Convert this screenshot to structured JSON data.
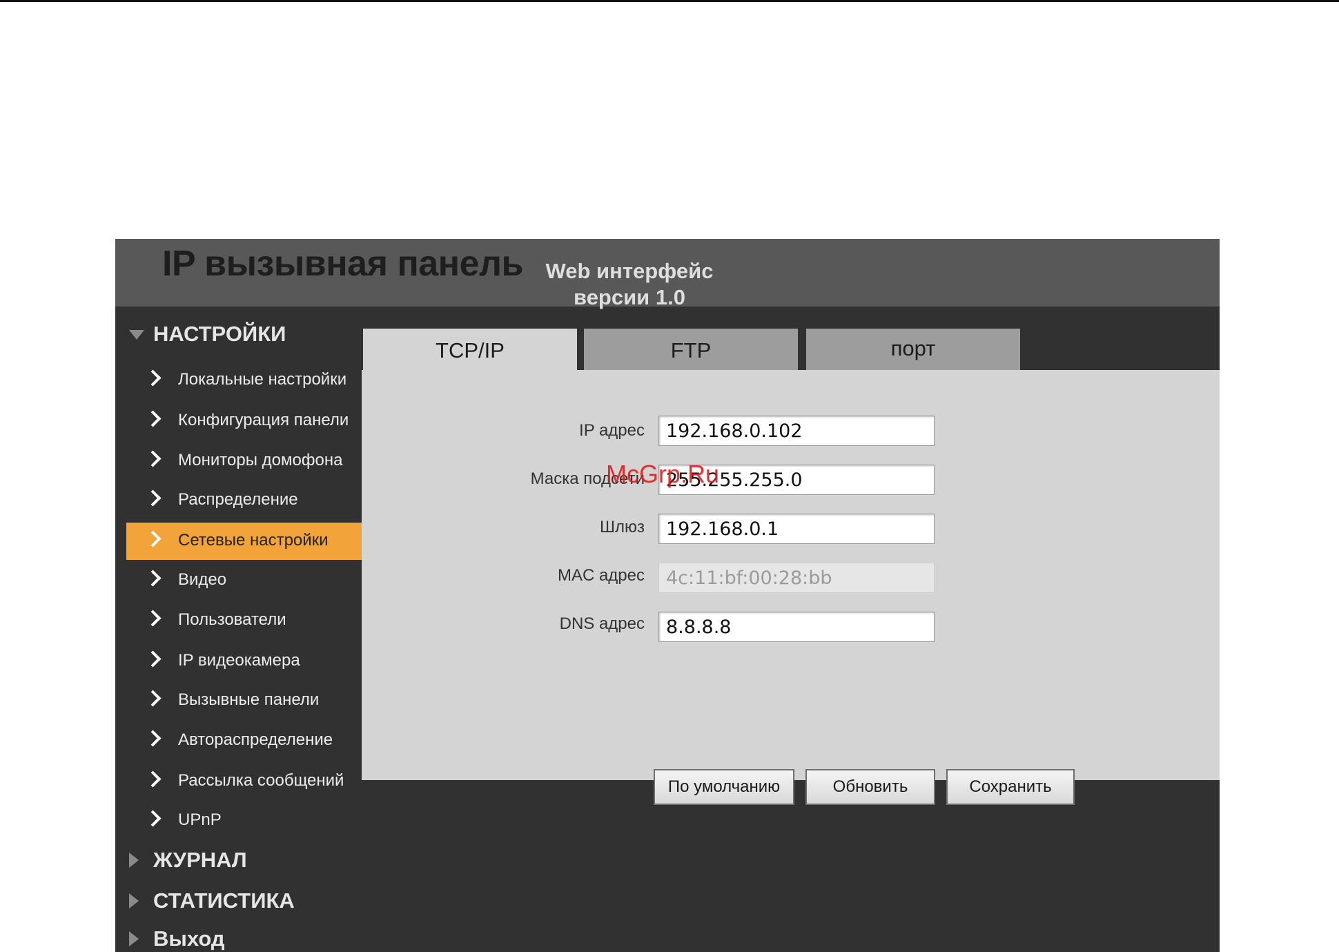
{
  "header": {
    "title": "IP вызывная панель",
    "subtitle_line1": "Web интерфейс",
    "subtitle_line2": "версии 1.0"
  },
  "sidebar": {
    "sections": [
      {
        "label": "НАСТРОЙКИ",
        "expanded": true
      },
      {
        "label": "ЖУРНАЛ",
        "expanded": false
      },
      {
        "label": "СТАТИСТИКА",
        "expanded": false
      },
      {
        "label": "Выход",
        "expanded": false
      }
    ],
    "items": [
      {
        "label": "Локальные настройки",
        "active": false
      },
      {
        "label": "Конфигурация панели",
        "active": false
      },
      {
        "label": "Мониторы домофона",
        "active": false
      },
      {
        "label": "Распределение",
        "active": false
      },
      {
        "label": "Сетевые настройки",
        "active": true
      },
      {
        "label": "Видео",
        "active": false
      },
      {
        "label": "Пользователи",
        "active": false
      },
      {
        "label": "IP видеокамера",
        "active": false
      },
      {
        "label": "Вызывные панели",
        "active": false
      },
      {
        "label": "Автораспределение",
        "active": false
      },
      {
        "label": "Рассылка сообщений",
        "active": false
      },
      {
        "label": "UPnP",
        "active": false
      }
    ]
  },
  "tabs": [
    {
      "label": "TCP/IP",
      "active": true
    },
    {
      "label": "FTP",
      "active": false
    },
    {
      "label": "порт",
      "active": false
    }
  ],
  "form": {
    "ip_label": "IP адрес",
    "ip_value": "192.168.0.102",
    "mask_label": "Маска подсети",
    "mask_value": "255.255.255.0",
    "gateway_label": "Шлюз",
    "gateway_value": "192.168.0.1",
    "mac_label": "MAC адрес",
    "mac_value": "4c:11:bf:00:28:bb",
    "dns_label": "DNS адрес",
    "dns_value": "8.8.8.8"
  },
  "buttons": {
    "default_label": "По умолчанию",
    "refresh_label": "Обновить",
    "save_label": "Сохранить"
  },
  "watermark": "McGrp.Ru",
  "colors": {
    "active_item": "#f2a43a",
    "sidebar_bg": "#313131",
    "header_bg": "#585858",
    "content_bg": "#d4d4d4"
  }
}
